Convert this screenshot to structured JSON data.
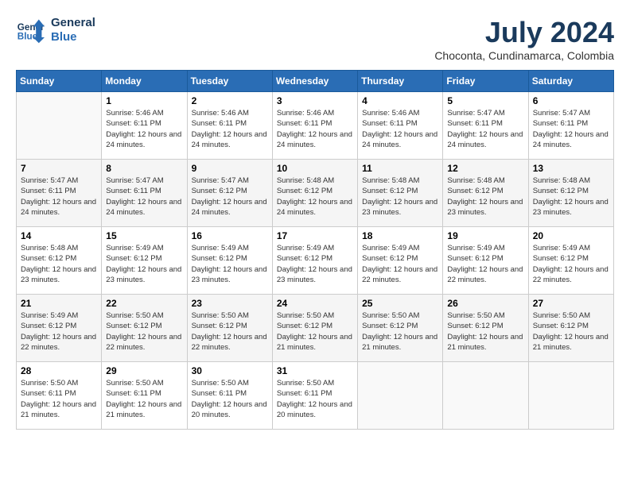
{
  "logo": {
    "line1": "General",
    "line2": "Blue"
  },
  "title": "July 2024",
  "location": "Choconta, Cundinamarca, Colombia",
  "days_header": [
    "Sunday",
    "Monday",
    "Tuesday",
    "Wednesday",
    "Thursday",
    "Friday",
    "Saturday"
  ],
  "weeks": [
    [
      {
        "day": "",
        "sunrise": "",
        "sunset": "",
        "daylight": ""
      },
      {
        "day": "1",
        "sunrise": "Sunrise: 5:46 AM",
        "sunset": "Sunset: 6:11 PM",
        "daylight": "Daylight: 12 hours and 24 minutes."
      },
      {
        "day": "2",
        "sunrise": "Sunrise: 5:46 AM",
        "sunset": "Sunset: 6:11 PM",
        "daylight": "Daylight: 12 hours and 24 minutes."
      },
      {
        "day": "3",
        "sunrise": "Sunrise: 5:46 AM",
        "sunset": "Sunset: 6:11 PM",
        "daylight": "Daylight: 12 hours and 24 minutes."
      },
      {
        "day": "4",
        "sunrise": "Sunrise: 5:46 AM",
        "sunset": "Sunset: 6:11 PM",
        "daylight": "Daylight: 12 hours and 24 minutes."
      },
      {
        "day": "5",
        "sunrise": "Sunrise: 5:47 AM",
        "sunset": "Sunset: 6:11 PM",
        "daylight": "Daylight: 12 hours and 24 minutes."
      },
      {
        "day": "6",
        "sunrise": "Sunrise: 5:47 AM",
        "sunset": "Sunset: 6:11 PM",
        "daylight": "Daylight: 12 hours and 24 minutes."
      }
    ],
    [
      {
        "day": "7",
        "sunrise": "Sunrise: 5:47 AM",
        "sunset": "Sunset: 6:11 PM",
        "daylight": "Daylight: 12 hours and 24 minutes."
      },
      {
        "day": "8",
        "sunrise": "Sunrise: 5:47 AM",
        "sunset": "Sunset: 6:11 PM",
        "daylight": "Daylight: 12 hours and 24 minutes."
      },
      {
        "day": "9",
        "sunrise": "Sunrise: 5:47 AM",
        "sunset": "Sunset: 6:12 PM",
        "daylight": "Daylight: 12 hours and 24 minutes."
      },
      {
        "day": "10",
        "sunrise": "Sunrise: 5:48 AM",
        "sunset": "Sunset: 6:12 PM",
        "daylight": "Daylight: 12 hours and 24 minutes."
      },
      {
        "day": "11",
        "sunrise": "Sunrise: 5:48 AM",
        "sunset": "Sunset: 6:12 PM",
        "daylight": "Daylight: 12 hours and 23 minutes."
      },
      {
        "day": "12",
        "sunrise": "Sunrise: 5:48 AM",
        "sunset": "Sunset: 6:12 PM",
        "daylight": "Daylight: 12 hours and 23 minutes."
      },
      {
        "day": "13",
        "sunrise": "Sunrise: 5:48 AM",
        "sunset": "Sunset: 6:12 PM",
        "daylight": "Daylight: 12 hours and 23 minutes."
      }
    ],
    [
      {
        "day": "14",
        "sunrise": "Sunrise: 5:48 AM",
        "sunset": "Sunset: 6:12 PM",
        "daylight": "Daylight: 12 hours and 23 minutes."
      },
      {
        "day": "15",
        "sunrise": "Sunrise: 5:49 AM",
        "sunset": "Sunset: 6:12 PM",
        "daylight": "Daylight: 12 hours and 23 minutes."
      },
      {
        "day": "16",
        "sunrise": "Sunrise: 5:49 AM",
        "sunset": "Sunset: 6:12 PM",
        "daylight": "Daylight: 12 hours and 23 minutes."
      },
      {
        "day": "17",
        "sunrise": "Sunrise: 5:49 AM",
        "sunset": "Sunset: 6:12 PM",
        "daylight": "Daylight: 12 hours and 23 minutes."
      },
      {
        "day": "18",
        "sunrise": "Sunrise: 5:49 AM",
        "sunset": "Sunset: 6:12 PM",
        "daylight": "Daylight: 12 hours and 22 minutes."
      },
      {
        "day": "19",
        "sunrise": "Sunrise: 5:49 AM",
        "sunset": "Sunset: 6:12 PM",
        "daylight": "Daylight: 12 hours and 22 minutes."
      },
      {
        "day": "20",
        "sunrise": "Sunrise: 5:49 AM",
        "sunset": "Sunset: 6:12 PM",
        "daylight": "Daylight: 12 hours and 22 minutes."
      }
    ],
    [
      {
        "day": "21",
        "sunrise": "Sunrise: 5:49 AM",
        "sunset": "Sunset: 6:12 PM",
        "daylight": "Daylight: 12 hours and 22 minutes."
      },
      {
        "day": "22",
        "sunrise": "Sunrise: 5:50 AM",
        "sunset": "Sunset: 6:12 PM",
        "daylight": "Daylight: 12 hours and 22 minutes."
      },
      {
        "day": "23",
        "sunrise": "Sunrise: 5:50 AM",
        "sunset": "Sunset: 6:12 PM",
        "daylight": "Daylight: 12 hours and 22 minutes."
      },
      {
        "day": "24",
        "sunrise": "Sunrise: 5:50 AM",
        "sunset": "Sunset: 6:12 PM",
        "daylight": "Daylight: 12 hours and 21 minutes."
      },
      {
        "day": "25",
        "sunrise": "Sunrise: 5:50 AM",
        "sunset": "Sunset: 6:12 PM",
        "daylight": "Daylight: 12 hours and 21 minutes."
      },
      {
        "day": "26",
        "sunrise": "Sunrise: 5:50 AM",
        "sunset": "Sunset: 6:12 PM",
        "daylight": "Daylight: 12 hours and 21 minutes."
      },
      {
        "day": "27",
        "sunrise": "Sunrise: 5:50 AM",
        "sunset": "Sunset: 6:12 PM",
        "daylight": "Daylight: 12 hours and 21 minutes."
      }
    ],
    [
      {
        "day": "28",
        "sunrise": "Sunrise: 5:50 AM",
        "sunset": "Sunset: 6:11 PM",
        "daylight": "Daylight: 12 hours and 21 minutes."
      },
      {
        "day": "29",
        "sunrise": "Sunrise: 5:50 AM",
        "sunset": "Sunset: 6:11 PM",
        "daylight": "Daylight: 12 hours and 21 minutes."
      },
      {
        "day": "30",
        "sunrise": "Sunrise: 5:50 AM",
        "sunset": "Sunset: 6:11 PM",
        "daylight": "Daylight: 12 hours and 20 minutes."
      },
      {
        "day": "31",
        "sunrise": "Sunrise: 5:50 AM",
        "sunset": "Sunset: 6:11 PM",
        "daylight": "Daylight: 12 hours and 20 minutes."
      },
      {
        "day": "",
        "sunrise": "",
        "sunset": "",
        "daylight": ""
      },
      {
        "day": "",
        "sunrise": "",
        "sunset": "",
        "daylight": ""
      },
      {
        "day": "",
        "sunrise": "",
        "sunset": "",
        "daylight": ""
      }
    ]
  ]
}
